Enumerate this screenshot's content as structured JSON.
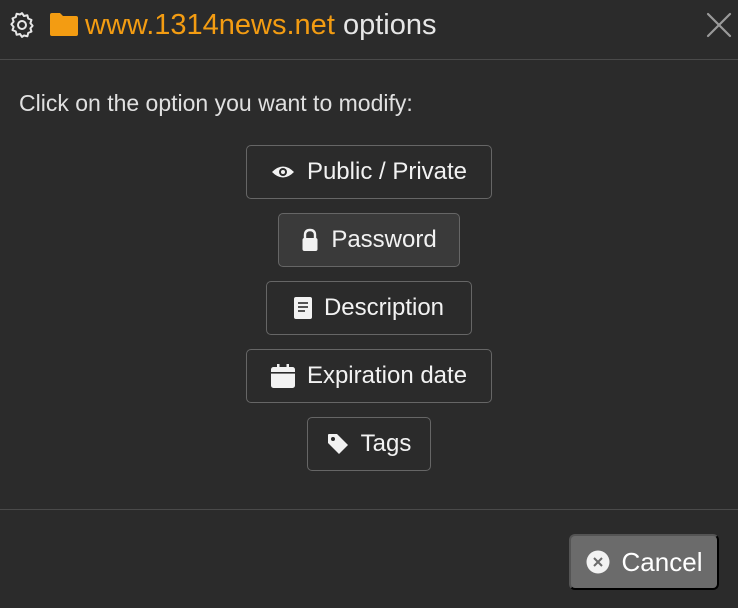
{
  "header": {
    "domain": "www.1314news.net",
    "suffix": "options",
    "gear_icon": "gear-icon",
    "folder_icon": "folder-icon",
    "close_icon": "close-icon",
    "accent_color": "#f39c12"
  },
  "prompt": "Click on the option you want to modify:",
  "options": [
    {
      "label": "Public / Private",
      "icon": "eye-icon"
    },
    {
      "label": "Password",
      "icon": "lock-icon"
    },
    {
      "label": "Description",
      "icon": "document-icon"
    },
    {
      "label": "Expiration date",
      "icon": "calendar-icon"
    },
    {
      "label": "Tags",
      "icon": "tag-icon"
    }
  ],
  "footer": {
    "cancel_label": "Cancel",
    "cancel_icon": "close-circle-icon"
  }
}
